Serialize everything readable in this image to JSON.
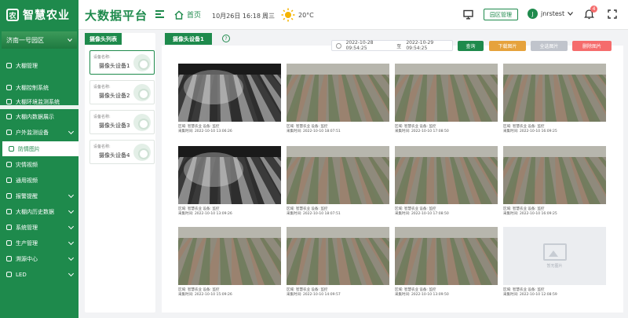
{
  "app": {
    "logo_text": "智慧农业",
    "logo_mark": "农",
    "platform_title": "大数据平台",
    "home_label": "首页",
    "date_time": "10月26日 16:18",
    "weekday": "周三",
    "temperature": "20°C",
    "garden_button": "园区管理",
    "user_initial": "J",
    "username": "jnrstest",
    "notification_count": "4"
  },
  "colors": {
    "brand_green": "#1e8a4c",
    "query_green": "#1e8a4c",
    "download_orange": "#e6a23c",
    "select_all_gray": "#c0c4cc",
    "delete_red": "#f56c6c"
  },
  "sidebar": {
    "area": "济南一号园区",
    "items": [
      {
        "label": "大棚管理",
        "icon": "greenhouse-icon",
        "arrow": false
      },
      {
        "label": "大棚控制系统",
        "icon": "control-icon",
        "arrow": false
      },
      {
        "label": "大棚环境监测系统",
        "icon": "monitor-icon",
        "arrow": false
      },
      {
        "label": "大棚内数据展示",
        "icon": "data-icon",
        "arrow": false
      },
      {
        "label": "户外监测设备",
        "icon": "outdoor-icon",
        "arrow": true
      },
      {
        "label": "防情图片",
        "icon": "image-icon",
        "arrow": false,
        "active": true
      },
      {
        "label": "灾情视频",
        "icon": "video-icon",
        "arrow": false
      },
      {
        "label": "通用视频",
        "icon": "camera-icon",
        "arrow": false
      },
      {
        "label": "报警提醒",
        "icon": "alarm-icon",
        "arrow": true
      },
      {
        "label": "大棚内历史数据",
        "icon": "history-icon",
        "arrow": true
      },
      {
        "label": "系统管理",
        "icon": "settings-icon",
        "arrow": true
      },
      {
        "label": "生产管理",
        "icon": "production-icon",
        "arrow": true
      },
      {
        "label": "溯源中心",
        "icon": "trace-icon",
        "arrow": true
      },
      {
        "label": "LED",
        "icon": "led-icon",
        "arrow": true
      }
    ]
  },
  "camera_list": {
    "title": "摄像头列表",
    "name_label": "设备名称:",
    "cameras": [
      "摄像头设备1",
      "摄像头设备2",
      "摄像头设备3",
      "摄像头设备4"
    ]
  },
  "main": {
    "tab": "摄像头设备1",
    "help": "?",
    "date_from": "2022-10-28  09:54:25",
    "date_sep": "至",
    "date_to": "2022-10-29  09:54:25",
    "buttons": {
      "query": "查询",
      "download": "下载图片",
      "select_all": "全选图片",
      "delete": "删除图片"
    },
    "no_image_label": "暂无图片",
    "images": [
      {
        "cap1": "区域: 智慧农业  设备: 监控",
        "cap2": "采集时间: 2022-10-10 13:06:26",
        "night": true
      },
      {
        "cap1": "区域: 智慧农业  设备: 监控",
        "cap2": "采集时间: 2022-10-10 18:07:51",
        "night": false
      },
      {
        "cap1": "区域: 智慧农业  设备: 监控",
        "cap2": "采集时间: 2022-10-10 17:08:50",
        "night": false
      },
      {
        "cap1": "区域: 智慧农业  设备: 监控",
        "cap2": "采集时间: 2022-10-10 16:09:25",
        "night": false
      },
      {
        "cap1": "区域: 智慧农业  设备: 监控",
        "cap2": "采集时间: 2022-10-10 13:09:26",
        "night": true
      },
      {
        "cap1": "区域: 智慧农业  设备: 监控",
        "cap2": "采集时间: 2022-10-10 18:07:51",
        "night": false
      },
      {
        "cap1": "区域: 智慧农业  设备: 监控",
        "cap2": "采集时间: 2022-10-10 17:08:50",
        "night": false
      },
      {
        "cap1": "区域: 智慧农业  设备: 监控",
        "cap2": "采集时间: 2022-10-10 16:09:25",
        "night": false
      },
      {
        "cap1": "区域: 智慧农业  设备: 监控",
        "cap2": "采集时间: 2022-10-10 15:09:26",
        "night": false
      },
      {
        "cap1": "区域: 智慧农业  设备: 监控",
        "cap2": "采集时间: 2022-10-10 14:09:57",
        "night": false
      },
      {
        "cap1": "区域: 智慧农业  设备: 监控",
        "cap2": "采集时间: 2022-10-10 13:09:50",
        "night": false
      },
      {
        "cap1": "区域: 智慧农业  设备: 监控",
        "cap2": "采集时间: 2022-10-10 12:08:59",
        "none": true
      }
    ]
  }
}
